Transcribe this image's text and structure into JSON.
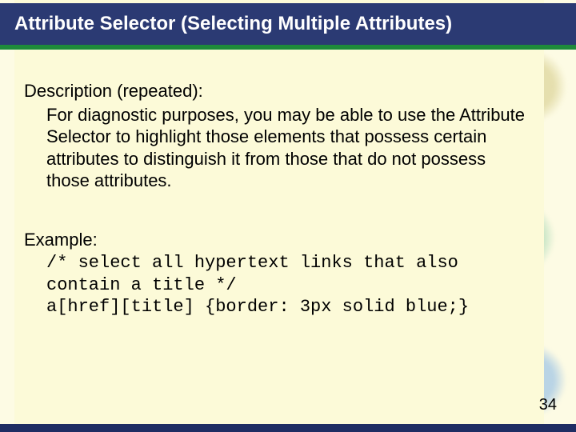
{
  "title": "Attribute Selector (Selecting Multiple Attributes)",
  "description_label": "Description (repeated):",
  "description_text": "For diagnostic purposes, you may be able to use the Attribute Selector to highlight those elements that possess certain attributes to distinguish it from those that do not possess those attributes.",
  "example_label": "Example:",
  "code_comment": "/* select all hypertext links that also contain a title */",
  "code_rule": "a[href][title] {border: 3px solid blue;}",
  "page_number": "34",
  "colors": {
    "title_bg": "#2b3a73",
    "accent_green": "#1e8a3a",
    "slide_bg": "#fcfad8"
  }
}
